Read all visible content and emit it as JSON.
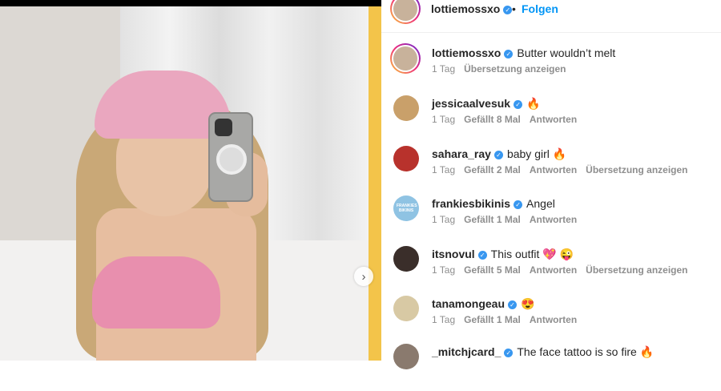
{
  "header": {
    "username": "lottiemossxo",
    "separator": "•",
    "follow_label": "Folgen"
  },
  "photo": {
    "next_icon": "chevron-right-icon",
    "next_glyph": "›"
  },
  "colors": {
    "accent": "#0095f6",
    "verified": "#3897f0",
    "meta": "#8e8e8e"
  },
  "comments": [
    {
      "user": "lottiemossxo",
      "text": "Butter wouldn’t melt",
      "time": "1 Tag",
      "likes": "",
      "reply": "",
      "translate": "Übersetzung anzeigen",
      "avatar_color": "#c8b29b",
      "ring": true
    },
    {
      "user": "jessicaalvesuk",
      "text": "🔥",
      "time": "1 Tag",
      "likes": "Gefällt 8 Mal",
      "reply": "Antworten",
      "translate": "",
      "avatar_color": "#c9a06a",
      "ring": false
    },
    {
      "user": "sahara_ray",
      "text": "baby girl 🔥",
      "time": "1 Tag",
      "likes": "Gefällt 2 Mal",
      "reply": "Antworten",
      "translate": "Übersetzung anzeigen",
      "avatar_color": "#b8322c",
      "ring": false
    },
    {
      "user": "frankiesbikinis",
      "text": "Angel",
      "time": "1 Tag",
      "likes": "Gefällt 1 Mal",
      "reply": "Antworten",
      "translate": "",
      "avatar_color": "#8fc3e3",
      "ring": false,
      "avatar_text": "FRANKIES BIKINIS"
    },
    {
      "user": "itsnovul",
      "text": "This outfit 💖 😜",
      "time": "1 Tag",
      "likes": "Gefällt 5 Mal",
      "reply": "Antworten",
      "translate": "Übersetzung anzeigen",
      "avatar_color": "#3a2e2a",
      "ring": false
    },
    {
      "user": "tanamongeau",
      "text": "😍",
      "time": "1 Tag",
      "likes": "Gefällt 1 Mal",
      "reply": "Antworten",
      "translate": "",
      "avatar_color": "#d8c9a4",
      "ring": false
    },
    {
      "user": "_mitchjcard_",
      "text": "The face tattoo is so fire 🔥",
      "time": "",
      "likes": "",
      "reply": "",
      "translate": "",
      "avatar_color": "#8a7a6e",
      "ring": false
    }
  ]
}
